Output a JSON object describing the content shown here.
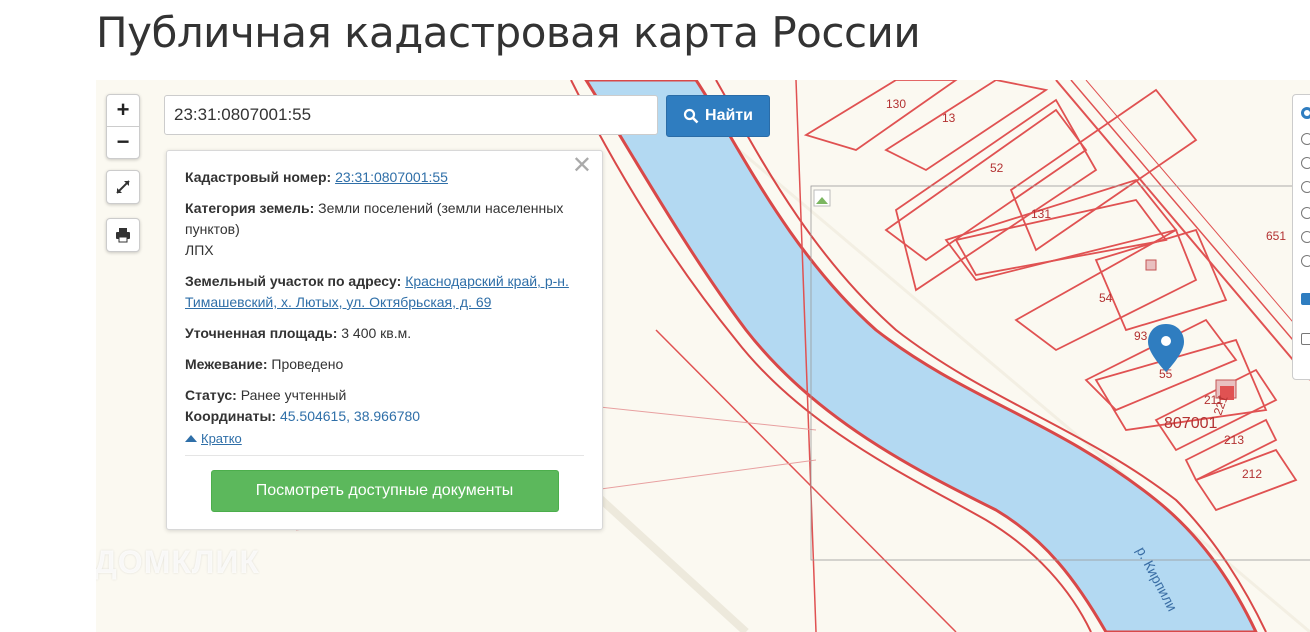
{
  "page": {
    "title": "Публичная кадастровая карта России"
  },
  "search": {
    "value": "23:31:0807001:55",
    "button_label": "Найти"
  },
  "zoom": {
    "in_label": "+",
    "out_label": "−"
  },
  "info": {
    "cadastral_label": "Кадастровый номер:",
    "cadastral_value": "23:31:0807001:55",
    "category_label": "Категория земель:",
    "category_value": "Земли поселений (земли населенных пунктов)",
    "use_value": "ЛПХ",
    "address_label": "Земельный участок по адресу:",
    "address_value": "Краснодарский край, р-н. Тимашевский, х. Лютых, ул. Октябрьская, д. 69",
    "area_label": "Уточненная площадь:",
    "area_value": "3 400 кв.м.",
    "survey_label": "Межевание:",
    "survey_value": "Проведено",
    "status_label": "Статус:",
    "status_value": "Ранее учтенный",
    "coords_label": "Координаты:",
    "coords_value": "45.504615, 38.966780",
    "brief_label": "Кратко",
    "docs_button": "Посмотреть доступные документы"
  },
  "map": {
    "parcels": [
      "130",
      "13",
      "52",
      "131",
      "54",
      "93",
      "55",
      "211",
      "221",
      "213",
      "212",
      "651"
    ],
    "quarter_label": "807001",
    "river_label": "р. Кирпили"
  },
  "watermark": "ДОМКЛИК",
  "colors": {
    "accent": "#2f7dc0",
    "success": "#5cb85c",
    "parcel_line": "#e05252",
    "river": "#b3d9f2"
  }
}
